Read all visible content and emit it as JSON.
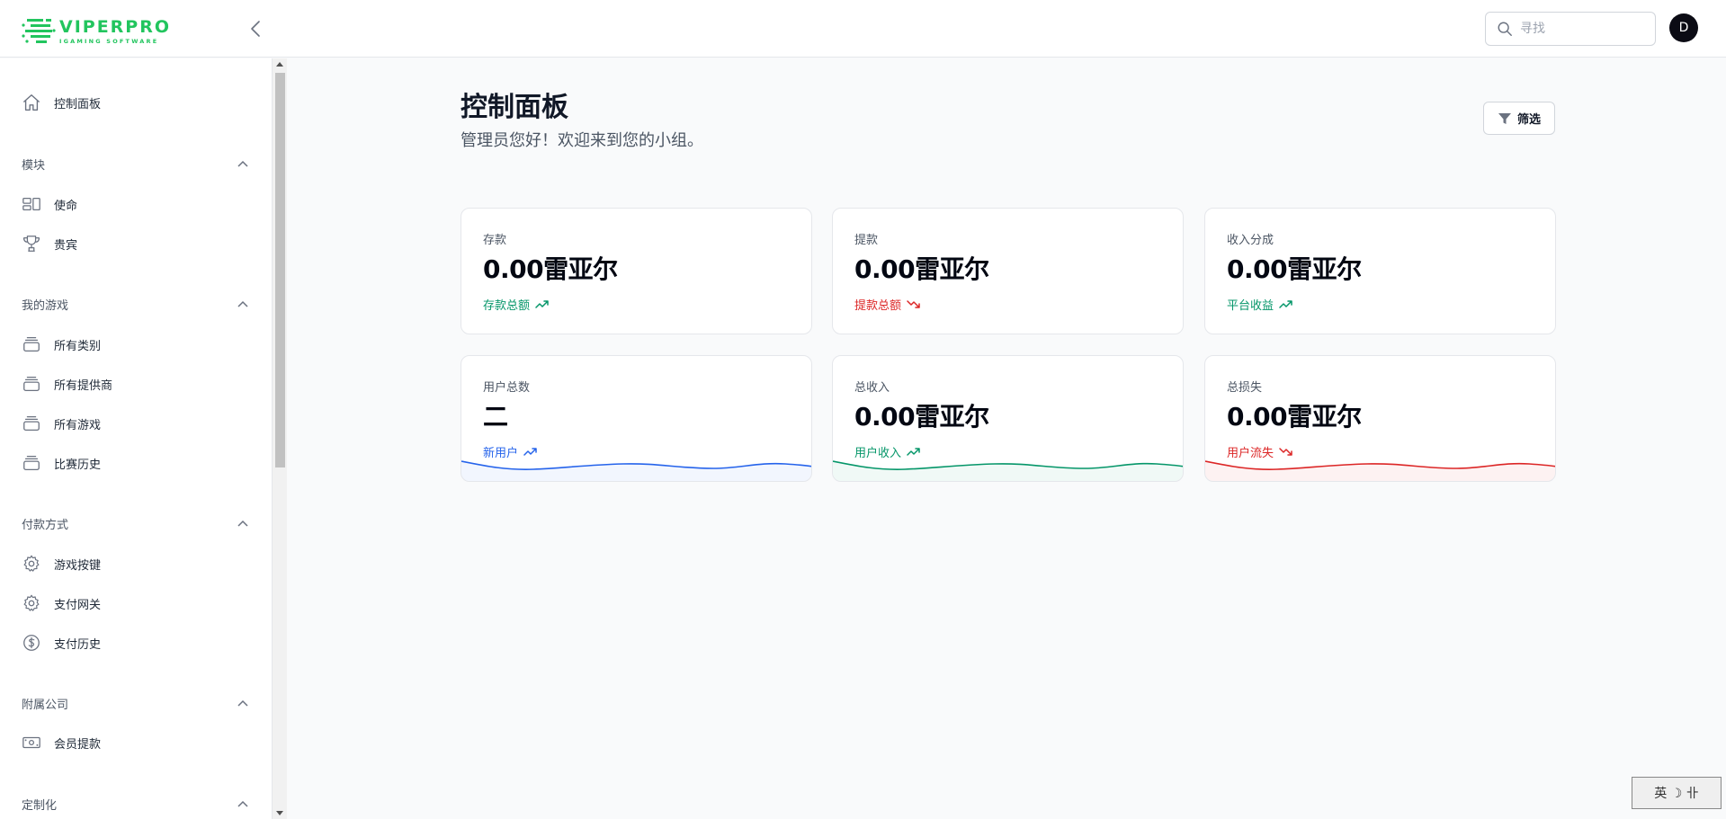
{
  "app": {
    "logo_title": "VIPERPRO",
    "logo_subtitle": "IGAMING SOFTWARE",
    "brand_color": "#22c55e"
  },
  "header": {
    "search_placeholder": "寻找",
    "avatar_initial": "D"
  },
  "sidebar": {
    "dashboard": "控制面板",
    "sections": {
      "modules": "模块",
      "my_games": "我的游戏",
      "payment": "付款方式",
      "affiliate": "附属公司",
      "custom": "定制化"
    },
    "items": {
      "mission": "使命",
      "vip": "贵宾",
      "all_categories": "所有类别",
      "all_providers": "所有提供商",
      "all_games": "所有游戏",
      "match_history": "比赛历史",
      "game_keys": "游戏按键",
      "payment_gateway": "支付网关",
      "payment_history": "支付历史",
      "member_withdrawal": "会员提款"
    }
  },
  "main": {
    "title": "控制面板",
    "subtitle": "管理员您好！欢迎来到您的小组。",
    "filter_label": "筛选",
    "cards": [
      {
        "label": "存款",
        "value": "0.00雷亚尔",
        "trend": "存款总额",
        "trend_dir": "up",
        "color": "#059669"
      },
      {
        "label": "提款",
        "value": "0.00雷亚尔",
        "trend": "提款总额",
        "trend_dir": "down",
        "color": "#dc2626"
      },
      {
        "label": "收入分成",
        "value": "0.00雷亚尔",
        "trend": "平台收益",
        "trend_dir": "up",
        "color": "#059669"
      },
      {
        "label": "用户总数",
        "value": "二",
        "trend": "新用户",
        "trend_dir": "up",
        "color": "#2563eb"
      },
      {
        "label": "总收入",
        "value": "0.00雷亚尔",
        "trend": "用户收入",
        "trend_dir": "up",
        "color": "#059669"
      },
      {
        "label": "总损失",
        "value": "0.00雷亚尔",
        "trend": "用户流失",
        "trend_dir": "down",
        "color": "#dc2626"
      }
    ]
  },
  "ime": {
    "text": "英 ☽ 卝"
  }
}
